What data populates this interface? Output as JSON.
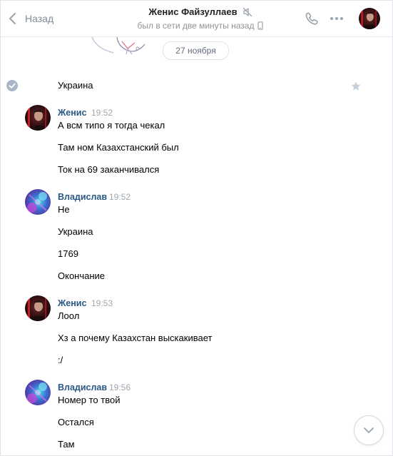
{
  "header": {
    "back_label": "Назад",
    "title": "Женис Файзуллаев",
    "status": "был в сети две минуты назад"
  },
  "date_divider": "27 ноября",
  "first_message_text": "Украина",
  "groups": [
    {
      "author": "Женис",
      "time": "19:52",
      "lines": [
        "А всм типо я тогда чекал",
        "Там ном Казахстанский был",
        "Ток на 69 заканчивался"
      ]
    },
    {
      "author": "Владислав",
      "time": "19:52",
      "lines": [
        "Не",
        "Украина",
        "1769",
        "Окончание"
      ]
    },
    {
      "author": "Женис",
      "time": "19:53",
      "lines": [
        "Лоол",
        "Хз а почему Казахстан выскакивает",
        ":/"
      ]
    },
    {
      "author": "Владислав",
      "time": "19:56",
      "lines": [
        "Номер то твой",
        "Остался",
        "Там"
      ]
    }
  ],
  "icons": {
    "back": "chevron-left-icon",
    "mute": "muted-speaker-icon",
    "device": "mobile-phone-icon",
    "call": "phone-icon",
    "more": "more-dots-icon",
    "selected": "check-circle-icon",
    "favorite": "star-icon",
    "scroll": "chevron-down-icon"
  },
  "colors": {
    "author_link": "#2a5885",
    "secondary_text": "#828a99",
    "time_text": "#a0a6ad",
    "icon_gray": "#99a2ad",
    "check_bg": "#a8b5c7"
  }
}
